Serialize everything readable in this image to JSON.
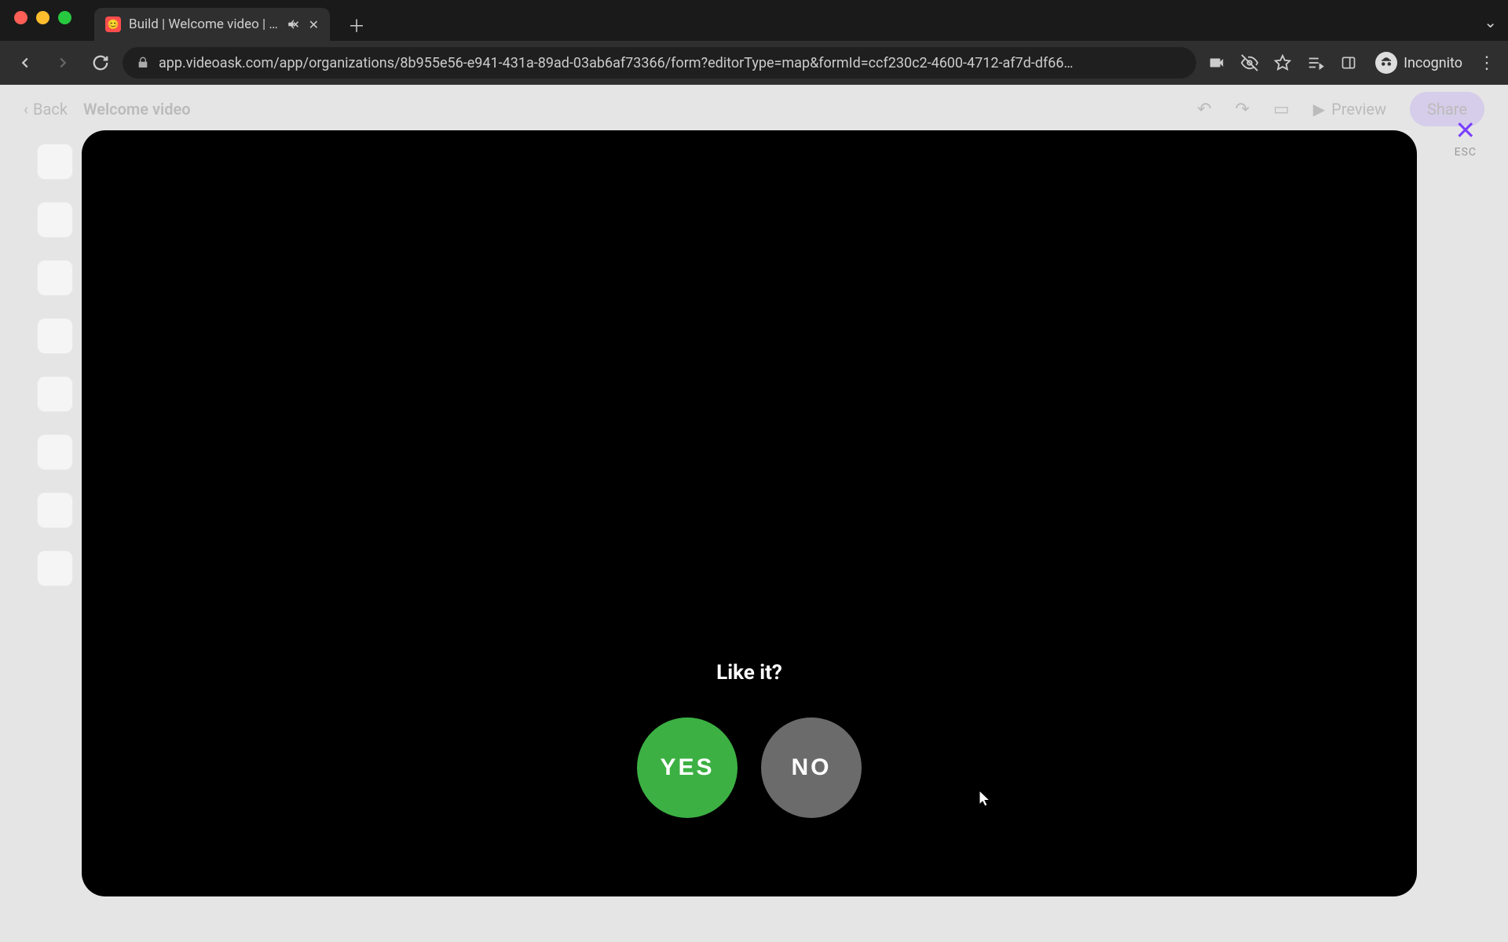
{
  "browser": {
    "tab_title": "Build | Welcome video | Vid",
    "url": "app.videoask.com/app/organizations/8b955e56-e941-431a-89ad-03ab6af73366/form?editorType=map&formId=ccf230c2-4600-4712-af7d-df66…",
    "incognito_label": "Incognito"
  },
  "app_header": {
    "back_label": "Back",
    "title": "Welcome video",
    "preview_label": "Preview",
    "share_label": "Share"
  },
  "modal": {
    "prompt": "Like it?",
    "yes_label": "YES",
    "no_label": "NO",
    "close_hint": "ESC"
  }
}
